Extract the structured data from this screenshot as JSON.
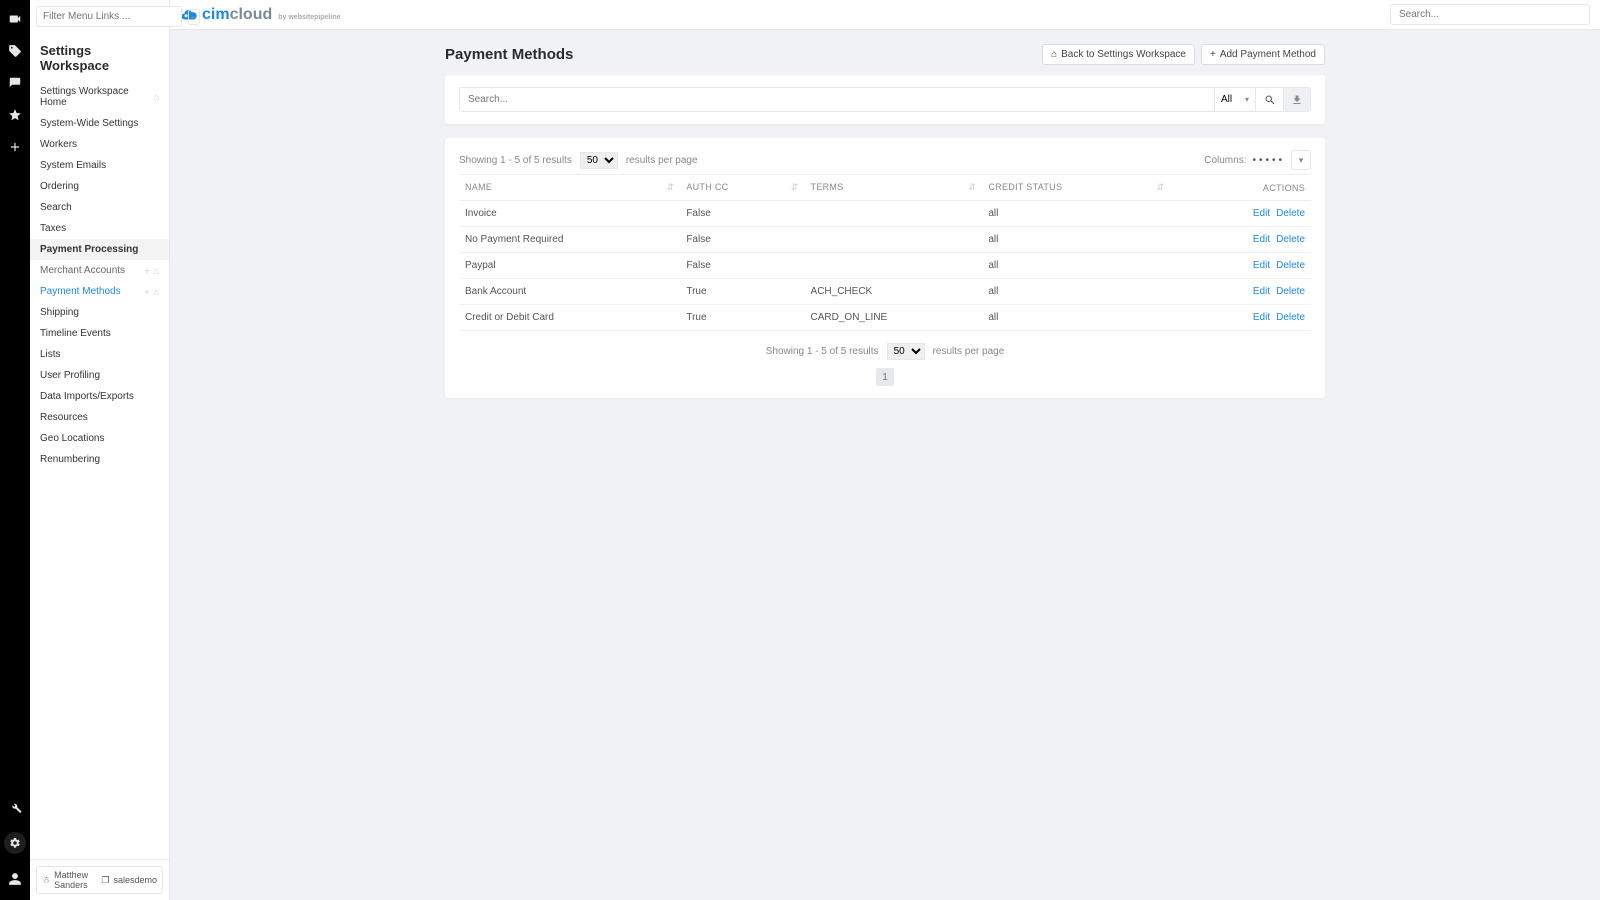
{
  "sidebar": {
    "filter_placeholder": "Filter Menu Links ...",
    "title": "Settings Workspace",
    "items": [
      {
        "label": "Settings Workspace Home",
        "home": true
      },
      {
        "label": "System-Wide Settings"
      },
      {
        "label": "Workers"
      },
      {
        "label": "System Emails"
      },
      {
        "label": "Ordering"
      },
      {
        "label": "Search"
      },
      {
        "label": "Taxes"
      },
      {
        "label": "Payment Processing",
        "active_parent": true
      },
      {
        "label": "Merchant Accounts",
        "sub": true,
        "subicons": true
      },
      {
        "label": "Payment Methods",
        "sub": true,
        "selected": true,
        "subicons": true
      },
      {
        "label": "Shipping"
      },
      {
        "label": "Timeline Events"
      },
      {
        "label": "Lists"
      },
      {
        "label": "User Profiling"
      },
      {
        "label": "Data Imports/Exports"
      },
      {
        "label": "Resources"
      },
      {
        "label": "Geo Locations"
      },
      {
        "label": "Renumbering"
      }
    ],
    "footer_user": "Matthew Sanders",
    "footer_env": "salesdemo"
  },
  "topbar": {
    "search_placeholder": "Search..."
  },
  "logo": {
    "part1": "cim",
    "part2": "cloud",
    "sub": "by websitepipeline"
  },
  "page": {
    "title": "Payment Methods",
    "back_label": "Back to Settings Workspace",
    "add_label": "Add Payment Method"
  },
  "filter": {
    "search_placeholder": "Search...",
    "scope_selected": "All"
  },
  "results": {
    "summary_top": "Showing 1 - 5 of 5 results",
    "summary_bottom": "Showing 1 - 5 of 5 results",
    "per_page_value": "50",
    "per_page_suffix": "results per page",
    "columns_label": "Columns:"
  },
  "table": {
    "headers": {
      "name": "NAME",
      "authcc": "AUTH CC",
      "terms": "TERMS",
      "credit": "CREDIT STATUS",
      "actions": "ACTIONS"
    },
    "rows": [
      {
        "name": "Invoice",
        "authcc": "False",
        "terms": "",
        "credit": "all"
      },
      {
        "name": "No Payment Required",
        "authcc": "False",
        "terms": "",
        "credit": "all"
      },
      {
        "name": "Paypal",
        "authcc": "False",
        "terms": "",
        "credit": "all"
      },
      {
        "name": "Bank Account",
        "authcc": "True",
        "terms": "ACH_CHECK",
        "credit": "all"
      },
      {
        "name": "Credit or Debit Card",
        "authcc": "True",
        "terms": "CARD_ON_LINE",
        "credit": "all"
      }
    ],
    "action_edit": "Edit",
    "action_delete": "Delete"
  },
  "pager": {
    "current": "1"
  }
}
